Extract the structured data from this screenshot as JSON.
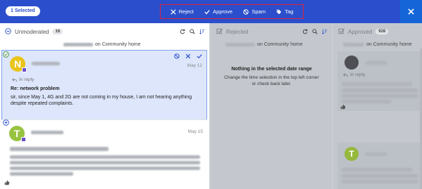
{
  "topbar": {
    "selected_label": "1 Selected",
    "actions": [
      {
        "label": "Reject",
        "icon": "x-icon"
      },
      {
        "label": "Approve",
        "icon": "check-icon"
      },
      {
        "label": "Spam",
        "icon": "block-icon"
      },
      {
        "label": "Tag",
        "icon": "tag-icon"
      }
    ],
    "accent": "#2b4fcc",
    "highlight_border": "#e01e3c"
  },
  "columns": {
    "unmoderated": {
      "title": "Unmoderated",
      "count": "16",
      "board": "on Community home",
      "cards": [
        {
          "avatar_letter": "N",
          "date": "May 12",
          "in_reply": "In reply",
          "subject": "Re: network problem",
          "body": "sir, since May 1, 4G and 2G are not coming in my house, I am not hearing anything despite repeated complaints."
        },
        {
          "avatar_letter": "T",
          "date": "May 15"
        }
      ]
    },
    "rejected": {
      "title": "Rejected",
      "board": "on Community home",
      "empty_title": "Nothing in the selected date range",
      "empty_text": "Change the time selection in the top left corner or check back later."
    },
    "approved": {
      "title": "Approved",
      "count": "928",
      "board": "on Community home",
      "in_reply": "In reply"
    }
  }
}
